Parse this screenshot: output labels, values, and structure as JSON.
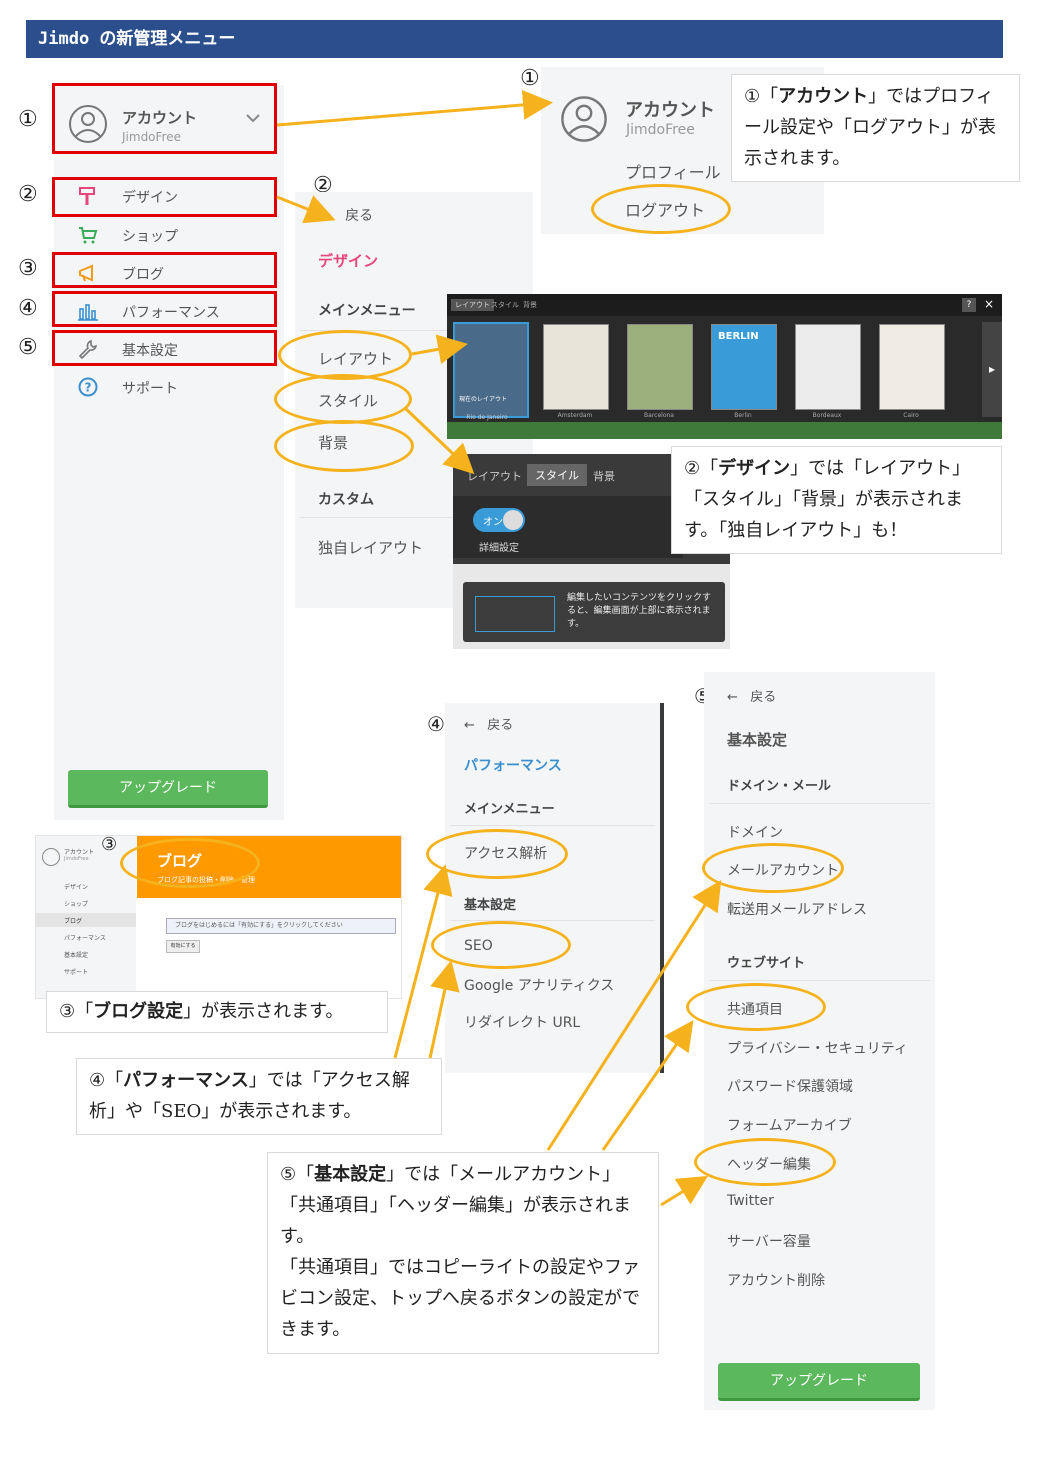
{
  "header": {
    "title": "Jimdo の新管理メニュー"
  },
  "numbers": {
    "n1": "①",
    "n2": "②",
    "n3": "③",
    "n4": "④",
    "n5": "⑤"
  },
  "main_sidebar": {
    "account_label": "アカウント",
    "account_sub": "JimdoFree",
    "items": [
      {
        "label": "デザイン",
        "icon": "paint-roller-icon"
      },
      {
        "label": "ショップ",
        "icon": "cart-icon"
      },
      {
        "label": "ブログ",
        "icon": "megaphone-icon"
      },
      {
        "label": "パフォーマンス",
        "icon": "bar-chart-icon"
      },
      {
        "label": "基本設定",
        "icon": "wrench-icon"
      },
      {
        "label": "サポート",
        "icon": "help-icon"
      }
    ],
    "upgrade": "アップグレード"
  },
  "account_panel": {
    "account_label": "アカウント",
    "account_sub": "JimdoFree",
    "profile": "プロフィール",
    "logout": "ログアウト"
  },
  "callout1": {
    "pre": "①「",
    "bold": "アカウント",
    "post": "」ではプロフィール設定や「ログアウト」が表示されます。"
  },
  "design_panel": {
    "back": "戻る",
    "title": "デザイン",
    "section_main": "メインメニュー",
    "items": [
      "レイアウト",
      "スタイル",
      "背景"
    ],
    "section_custom": "カスタム",
    "custom_item": "独自レイアウト"
  },
  "layout_gallery": {
    "tabs": [
      "レイアウト",
      "スタイル",
      "背景"
    ],
    "help": "?",
    "close": "×",
    "current_label": "現在のレイアウト",
    "thumb_titles": [
      "Rio de Janeiro",
      "Amsterdam",
      "Barcelona",
      "Berlin",
      "Bordeaux",
      "Cairo"
    ],
    "berlin_text": "BERLIN"
  },
  "style_panel": {
    "tabs": [
      "レイアウト",
      "スタイル",
      "背景"
    ],
    "toggle": "オン",
    "detail": "詳細設定",
    "hint": "編集したいコンテンツをクリックすると、編集画面が上部に表示されます。"
  },
  "callout2": {
    "pre": "②「",
    "bold": "デザイン",
    "post": "」では「レイアウト」「スタイル」「背景」が表示されます。「独自レイアウト」も！"
  },
  "blog_panel": {
    "mini_items": [
      "アカウント",
      "デザイン",
      "ショップ",
      "ブログ",
      "パフォーマンス",
      "基本設定",
      "サポート"
    ],
    "mini_sub": "JimdoFree",
    "title": "ブログ",
    "subtitle": "ブログ記事の投稿・削除・管理",
    "notice": "ブログをはじめるには「有効にする」をクリックしてください",
    "button": "有効にする"
  },
  "callout3": {
    "pre": "③「",
    "bold": "ブログ設定",
    "post": "」が表示されます。"
  },
  "performance_panel": {
    "back": "戻る",
    "title": "パフォーマンス",
    "section_main": "メインメニュー",
    "item_access": "アクセス解析",
    "section_basic": "基本設定",
    "items": [
      "SEO",
      "Google アナリティクス",
      "リダイレクト URL"
    ]
  },
  "callout4": {
    "pre": "④「",
    "bold": "パフォーマンス",
    "post": "」では「アクセス解析」や「SEO」が表示されます。"
  },
  "settings_panel": {
    "back": "戻る",
    "title": "基本設定",
    "section_domain": "ドメイン・メール",
    "domain_items": [
      "ドメイン",
      "メールアカウント",
      "転送用メールアドレス"
    ],
    "section_website": "ウェブサイト",
    "website_items": [
      "共通項目",
      "プライバシー・セキュリティ",
      "パスワード保護領域",
      "フォームアーカイブ",
      "ヘッダー編集",
      "Twitter",
      "サーバー容量",
      "アカウント削除"
    ],
    "upgrade": "アップグレード"
  },
  "callout5": {
    "pre": "⑤「",
    "bold": "基本設定",
    "post": "」では「メールアカウント」「共通項目」「ヘッダー編集」が表示されます。",
    "line2": "「共通項目」ではコピーライトの設定やファビコン設定、トップへ戻るボタンの設定ができます。"
  },
  "colors": {
    "header": "#2b4f8c",
    "red": "#e00000",
    "yellow": "#f5b21c",
    "green": "#5cb85c",
    "orange": "#ff9900",
    "pink": "#e8457a",
    "blue": "#3a8fd0"
  }
}
